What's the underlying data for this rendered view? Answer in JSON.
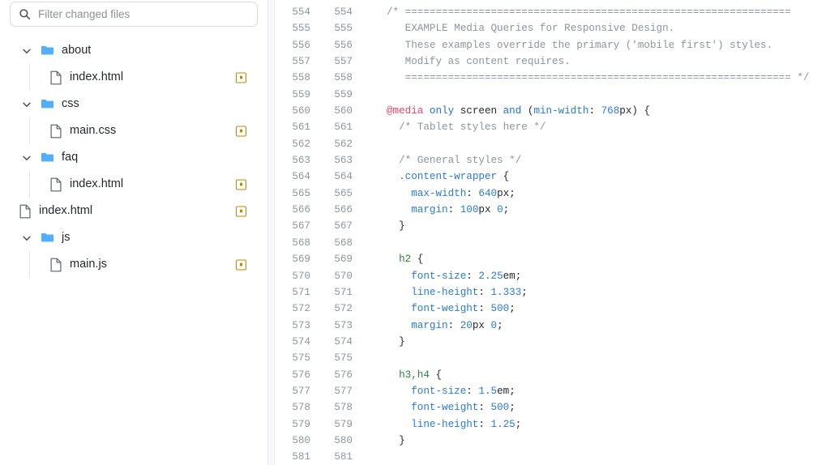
{
  "filter": {
    "placeholder": "Filter changed files",
    "value": "",
    "icon": "search-icon"
  },
  "tree": {
    "items": [
      {
        "label": "about",
        "type": "folder",
        "depth": 0,
        "expanded": true,
        "chevron": "chevron-down-icon",
        "badge": false
      },
      {
        "label": "index.html",
        "type": "file",
        "depth": 1,
        "expanded": null,
        "chevron": null,
        "badge": true
      },
      {
        "label": "css",
        "type": "folder",
        "depth": 0,
        "expanded": true,
        "chevron": "chevron-down-icon",
        "badge": false
      },
      {
        "label": "main.css",
        "type": "file",
        "depth": 1,
        "expanded": null,
        "chevron": null,
        "badge": true
      },
      {
        "label": "faq",
        "type": "folder",
        "depth": 0,
        "expanded": true,
        "chevron": "chevron-down-icon",
        "badge": false
      },
      {
        "label": "index.html",
        "type": "file",
        "depth": 1,
        "expanded": null,
        "chevron": null,
        "badge": true
      },
      {
        "label": "index.html",
        "type": "file",
        "depth": 0,
        "expanded": null,
        "chevron": null,
        "badge": true
      },
      {
        "label": "js",
        "type": "folder",
        "depth": 0,
        "expanded": true,
        "chevron": "chevron-down-icon",
        "badge": false
      },
      {
        "label": "main.js",
        "type": "file",
        "depth": 1,
        "expanded": null,
        "chevron": null,
        "badge": true
      }
    ]
  },
  "colors": {
    "folder_icon": "#54aeff",
    "file_icon": "#57606a",
    "badge_border": "#bf8700",
    "badge_dot": "#bf8700",
    "line_number": "#8c959f",
    "comment": "#8b949e",
    "atrule": "#e3456b",
    "keyword": "#1f6fd0",
    "selector_class": "#2b7ad1",
    "selector_tag": "#2c8045",
    "property": "#2b7ad1",
    "number": "#2b7ad1",
    "text": "#24292e",
    "gutter_bg": "#f6f8fa"
  },
  "diff": {
    "language": "css",
    "lines": [
      {
        "old": "554",
        "new": "554",
        "tokens": [
          {
            "t": "/* ===============================================================",
            "c": "comment"
          }
        ]
      },
      {
        "old": "555",
        "new": "555",
        "tokens": [
          {
            "t": "   EXAMPLE Media Queries for Responsive Design.",
            "c": "comment"
          }
        ]
      },
      {
        "old": "556",
        "new": "556",
        "tokens": [
          {
            "t": "   These examples override the primary ('mobile first') styles.",
            "c": "comment"
          }
        ]
      },
      {
        "old": "557",
        "new": "557",
        "tokens": [
          {
            "t": "   Modify as content requires.",
            "c": "comment"
          }
        ]
      },
      {
        "old": "558",
        "new": "558",
        "tokens": [
          {
            "t": "   =============================================================== */",
            "c": "comment"
          }
        ]
      },
      {
        "old": "559",
        "new": "559",
        "tokens": []
      },
      {
        "old": "560",
        "new": "560",
        "tokens": [
          {
            "t": "@media",
            "c": "atrule"
          },
          {
            "t": " ",
            "c": "plain"
          },
          {
            "t": "only",
            "c": "keyword"
          },
          {
            "t": " screen ",
            "c": "plain"
          },
          {
            "t": "and",
            "c": "keyword"
          },
          {
            "t": " (",
            "c": "punct"
          },
          {
            "t": "min-width",
            "c": "prop"
          },
          {
            "t": ": ",
            "c": "punct"
          },
          {
            "t": "768",
            "c": "num"
          },
          {
            "t": "px",
            "c": "unit"
          },
          {
            "t": ") {",
            "c": "punct"
          }
        ]
      },
      {
        "old": "561",
        "new": "561",
        "tokens": [
          {
            "t": "  /* Tablet styles here */",
            "c": "comment"
          }
        ]
      },
      {
        "old": "562",
        "new": "562",
        "tokens": []
      },
      {
        "old": "563",
        "new": "563",
        "tokens": [
          {
            "t": "  /* General styles */",
            "c": "comment"
          }
        ]
      },
      {
        "old": "564",
        "new": "564",
        "tokens": [
          {
            "t": "  ",
            "c": "plain"
          },
          {
            "t": ".content-wrapper",
            "c": "selclass"
          },
          {
            "t": " {",
            "c": "punct"
          }
        ]
      },
      {
        "old": "565",
        "new": "565",
        "tokens": [
          {
            "t": "    ",
            "c": "plain"
          },
          {
            "t": "max-width",
            "c": "prop"
          },
          {
            "t": ": ",
            "c": "punct"
          },
          {
            "t": "640",
            "c": "num"
          },
          {
            "t": "px",
            "c": "unit"
          },
          {
            "t": ";",
            "c": "punct"
          }
        ]
      },
      {
        "old": "566",
        "new": "566",
        "tokens": [
          {
            "t": "    ",
            "c": "plain"
          },
          {
            "t": "margin",
            "c": "prop"
          },
          {
            "t": ": ",
            "c": "punct"
          },
          {
            "t": "100",
            "c": "num"
          },
          {
            "t": "px ",
            "c": "unit"
          },
          {
            "t": "0",
            "c": "num"
          },
          {
            "t": ";",
            "c": "punct"
          }
        ]
      },
      {
        "old": "567",
        "new": "567",
        "tokens": [
          {
            "t": "  }",
            "c": "punct"
          }
        ]
      },
      {
        "old": "568",
        "new": "568",
        "tokens": []
      },
      {
        "old": "569",
        "new": "569",
        "tokens": [
          {
            "t": "  ",
            "c": "plain"
          },
          {
            "t": "h2",
            "c": "seltag"
          },
          {
            "t": " {",
            "c": "punct"
          }
        ]
      },
      {
        "old": "570",
        "new": "570",
        "tokens": [
          {
            "t": "    ",
            "c": "plain"
          },
          {
            "t": "font-size",
            "c": "prop"
          },
          {
            "t": ": ",
            "c": "punct"
          },
          {
            "t": "2.25",
            "c": "num"
          },
          {
            "t": "em",
            "c": "unit"
          },
          {
            "t": ";",
            "c": "punct"
          }
        ]
      },
      {
        "old": "571",
        "new": "571",
        "tokens": [
          {
            "t": "    ",
            "c": "plain"
          },
          {
            "t": "line-height",
            "c": "prop"
          },
          {
            "t": ": ",
            "c": "punct"
          },
          {
            "t": "1.333",
            "c": "num"
          },
          {
            "t": ";",
            "c": "punct"
          }
        ]
      },
      {
        "old": "572",
        "new": "572",
        "tokens": [
          {
            "t": "    ",
            "c": "plain"
          },
          {
            "t": "font-weight",
            "c": "prop"
          },
          {
            "t": ": ",
            "c": "punct"
          },
          {
            "t": "500",
            "c": "num"
          },
          {
            "t": ";",
            "c": "punct"
          }
        ]
      },
      {
        "old": "573",
        "new": "573",
        "tokens": [
          {
            "t": "    ",
            "c": "plain"
          },
          {
            "t": "margin",
            "c": "prop"
          },
          {
            "t": ": ",
            "c": "punct"
          },
          {
            "t": "20",
            "c": "num"
          },
          {
            "t": "px ",
            "c": "unit"
          },
          {
            "t": "0",
            "c": "num"
          },
          {
            "t": ";",
            "c": "punct"
          }
        ]
      },
      {
        "old": "574",
        "new": "574",
        "tokens": [
          {
            "t": "  }",
            "c": "punct"
          }
        ]
      },
      {
        "old": "575",
        "new": "575",
        "tokens": []
      },
      {
        "old": "576",
        "new": "576",
        "tokens": [
          {
            "t": "  ",
            "c": "plain"
          },
          {
            "t": "h3,h4",
            "c": "seltag"
          },
          {
            "t": " {",
            "c": "punct"
          }
        ]
      },
      {
        "old": "577",
        "new": "577",
        "tokens": [
          {
            "t": "    ",
            "c": "plain"
          },
          {
            "t": "font-size",
            "c": "prop"
          },
          {
            "t": ": ",
            "c": "punct"
          },
          {
            "t": "1.5",
            "c": "num"
          },
          {
            "t": "em",
            "c": "unit"
          },
          {
            "t": ";",
            "c": "punct"
          }
        ]
      },
      {
        "old": "578",
        "new": "578",
        "tokens": [
          {
            "t": "    ",
            "c": "plain"
          },
          {
            "t": "font-weight",
            "c": "prop"
          },
          {
            "t": ": ",
            "c": "punct"
          },
          {
            "t": "500",
            "c": "num"
          },
          {
            "t": ";",
            "c": "punct"
          }
        ]
      },
      {
        "old": "579",
        "new": "579",
        "tokens": [
          {
            "t": "    ",
            "c": "plain"
          },
          {
            "t": "line-height",
            "c": "prop"
          },
          {
            "t": ": ",
            "c": "punct"
          },
          {
            "t": "1.25",
            "c": "num"
          },
          {
            "t": ";",
            "c": "punct"
          }
        ]
      },
      {
        "old": "580",
        "new": "580",
        "tokens": [
          {
            "t": "  }",
            "c": "punct"
          }
        ]
      },
      {
        "old": "581",
        "new": "581",
        "tokens": []
      }
    ]
  }
}
